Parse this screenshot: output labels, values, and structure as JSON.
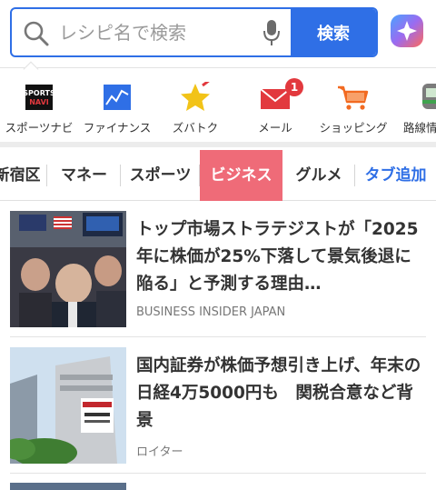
{
  "search": {
    "placeholder": "レシピ名で検索",
    "button_label": "検索"
  },
  "services": [
    {
      "label": "スポーツナビ",
      "icon": "sportsnavi-logo"
    },
    {
      "label": "ファイナンス",
      "icon": "finance-chart-icon"
    },
    {
      "label": "ズバトク",
      "icon": "star-icon"
    },
    {
      "label": "メール",
      "icon": "mail-icon",
      "badge": "1"
    },
    {
      "label": "ショッピング",
      "icon": "cart-icon"
    },
    {
      "label": "路線情",
      "icon": "train-icon"
    }
  ],
  "tabs": [
    {
      "label": "新宿区"
    },
    {
      "label": "マネー"
    },
    {
      "label": "スポーツ"
    },
    {
      "label": "ビジネス",
      "active": true
    },
    {
      "label": "グルメ"
    },
    {
      "label": "タブ追加"
    }
  ],
  "articles": [
    {
      "title": "トップ市場ストラテジストが「2025年に株価が25%下落して景気後退に陥る」と予測する理由…",
      "source": "BUSINESS INSIDER JAPAN"
    },
    {
      "title": "国内証券が株価予想引き上げ、年末の日経4万5000円も　関税合意など背景",
      "source": "ロイター"
    }
  ],
  "colors": {
    "accent_blue": "#2f6fe6",
    "active_tab": "#ef6b78",
    "badge_red": "#e2393e"
  }
}
